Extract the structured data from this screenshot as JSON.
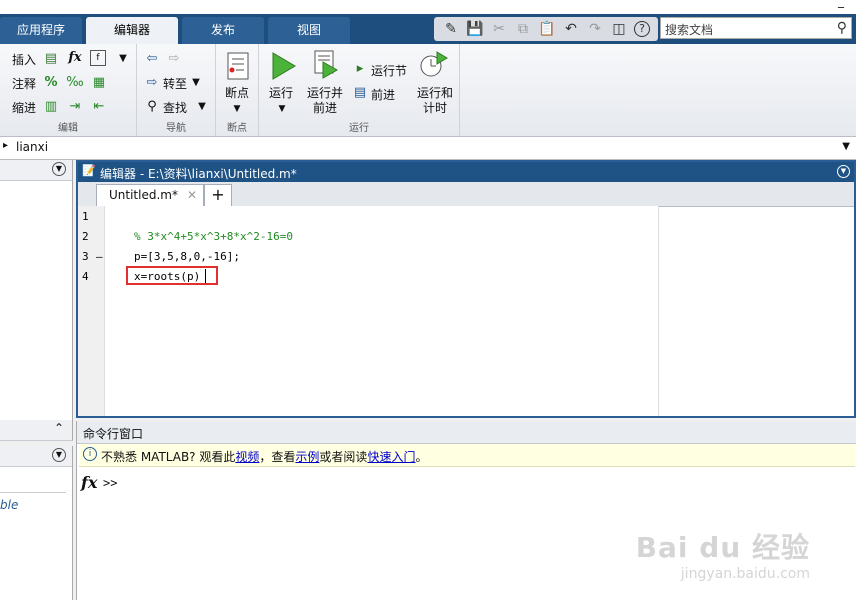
{
  "window": {
    "title_bar_glyph": "_"
  },
  "tabs": [
    {
      "label": "应用程序"
    },
    {
      "label": "编辑器"
    },
    {
      "label": "发布"
    },
    {
      "label": "视图"
    }
  ],
  "search": {
    "placeholder": "搜索文档"
  },
  "ribbon": {
    "edit_group": {
      "label": "编辑",
      "rows": [
        "插入",
        "注释",
        "缩进"
      ],
      "fx_glyph": "fx",
      "percent_glyph": "%"
    },
    "nav_group": {
      "label": "导航",
      "goto": "转至",
      "find": "查找"
    },
    "breakpoint_group": {
      "label": "断点",
      "breakpoints": "断点"
    },
    "run_group": {
      "label": "运行",
      "run": "运行",
      "run_advance_1": "运行并",
      "run_advance_2": "前进",
      "run_section": "运行节",
      "advance": "前进",
      "run_time_1": "运行和",
      "run_time_2": "计时"
    }
  },
  "address": {
    "path": "lianxi"
  },
  "editor": {
    "title": "编辑器 - E:\\资料\\lianxi\\Untitled.m*",
    "tab_label": "Untitled.m*",
    "add_tab": "+",
    "lines": [
      {
        "num": "1",
        "marker": "",
        "text": ""
      },
      {
        "num": "2",
        "marker": "",
        "text": "% 3*x^4+5*x^3+8*x^2-16=0"
      },
      {
        "num": "3",
        "marker": "–",
        "text": "p=[3,5,8,0,-16];"
      },
      {
        "num": "4",
        "marker": "",
        "text": "x=roots(p)"
      }
    ],
    "comment_color": "#228b22",
    "highlight_color": "#e03030"
  },
  "left_panel": {
    "partial_text": "ble"
  },
  "command_window": {
    "title": "命令行窗口",
    "notice_pre": "不熟悉 MATLAB? 观看此",
    "notice_link1": "视频",
    "notice_mid1": "，查看",
    "notice_link2": "示例",
    "notice_mid2": "或者阅读",
    "notice_link3": "快速入门",
    "notice_end": "。",
    "fx": "fx",
    "prompt": ">>"
  },
  "watermark": {
    "brand": "Bai du 经验",
    "url": "jingyan.baidu.com"
  }
}
